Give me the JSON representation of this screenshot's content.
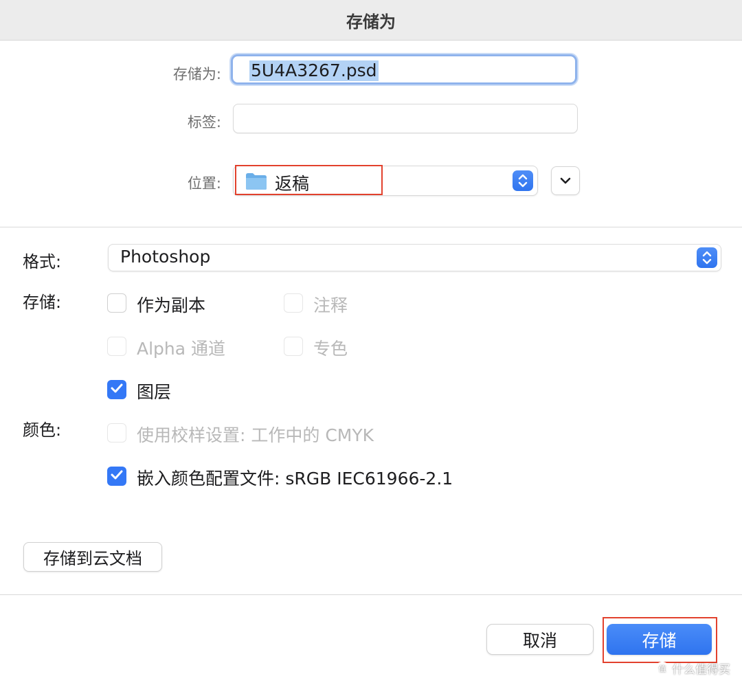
{
  "dialog": {
    "title": "存储为"
  },
  "top": {
    "save_as_label": "存储为:",
    "filename": "5U4A3267.psd",
    "tags_label": "标签:",
    "tags_value": "",
    "where_label": "位置:",
    "where_value": "返稿"
  },
  "options": {
    "format_label": "格式:",
    "format_value": "Photoshop",
    "save_label": "存储:",
    "color_label": "颜色:",
    "checkboxes": [
      {
        "label": "作为副本",
        "checked": false,
        "enabled": true
      },
      {
        "label": "注释",
        "checked": false,
        "enabled": false
      },
      {
        "label": "Alpha 通道",
        "checked": false,
        "enabled": false
      },
      {
        "label": "专色",
        "checked": false,
        "enabled": false
      },
      {
        "label": "图层",
        "checked": true,
        "enabled": true
      },
      {
        "label": "使用校样设置: 工作中的 CMYK",
        "checked": false,
        "enabled": false
      },
      {
        "label": "嵌入颜色配置文件: sRGB IEC61966-2.1",
        "checked": true,
        "enabled": true
      }
    ]
  },
  "buttons": {
    "icloud": "存储到云文档",
    "cancel": "取消",
    "save": "存储"
  },
  "watermark": {
    "text": "什么值得买",
    "badge": "值"
  },
  "colors": {
    "accent": "#3478f6",
    "highlight": "#e2412d",
    "titlebar": "#ececec"
  }
}
